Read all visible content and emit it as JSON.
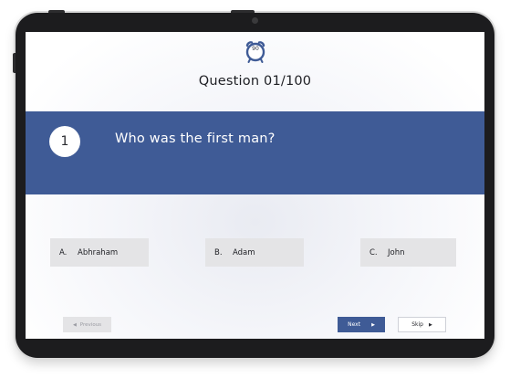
{
  "timer": {
    "value": "90",
    "icon": "alarm-clock-icon"
  },
  "header": {
    "question_counter": "Question 01/100"
  },
  "question": {
    "number": "1",
    "text": "Who was the first man?"
  },
  "options": [
    {
      "letter": "A.",
      "text": "Abhraham"
    },
    {
      "letter": "B.",
      "text": "Adam"
    },
    {
      "letter": "C.",
      "text": "John"
    }
  ],
  "nav": {
    "previous_label": "Previous",
    "previous_icon": "left-arrow-icon",
    "next_label": "Next",
    "next_icon": "right-arrow-icon",
    "skip_label": "Skip",
    "skip_icon": "right-arrow-icon"
  },
  "colors": {
    "accent": "#3f5b96",
    "option_bg": "#e4e4e6",
    "device_frame": "#1c1c1e"
  }
}
